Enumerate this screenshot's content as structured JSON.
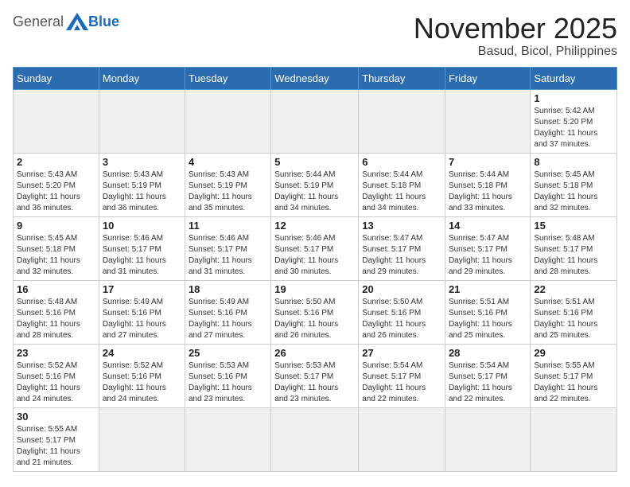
{
  "header": {
    "logo_general": "General",
    "logo_blue": "Blue",
    "month_title": "November 2025",
    "location": "Basud, Bicol, Philippines"
  },
  "weekdays": [
    "Sunday",
    "Monday",
    "Tuesday",
    "Wednesday",
    "Thursday",
    "Friday",
    "Saturday"
  ],
  "weeks": [
    [
      {
        "day": "",
        "info": ""
      },
      {
        "day": "",
        "info": ""
      },
      {
        "day": "",
        "info": ""
      },
      {
        "day": "",
        "info": ""
      },
      {
        "day": "",
        "info": ""
      },
      {
        "day": "",
        "info": ""
      },
      {
        "day": "1",
        "info": "Sunrise: 5:42 AM\nSunset: 5:20 PM\nDaylight: 11 hours\nand 37 minutes."
      }
    ],
    [
      {
        "day": "2",
        "info": "Sunrise: 5:43 AM\nSunset: 5:20 PM\nDaylight: 11 hours\nand 36 minutes."
      },
      {
        "day": "3",
        "info": "Sunrise: 5:43 AM\nSunset: 5:19 PM\nDaylight: 11 hours\nand 36 minutes."
      },
      {
        "day": "4",
        "info": "Sunrise: 5:43 AM\nSunset: 5:19 PM\nDaylight: 11 hours\nand 35 minutes."
      },
      {
        "day": "5",
        "info": "Sunrise: 5:44 AM\nSunset: 5:19 PM\nDaylight: 11 hours\nand 34 minutes."
      },
      {
        "day": "6",
        "info": "Sunrise: 5:44 AM\nSunset: 5:18 PM\nDaylight: 11 hours\nand 34 minutes."
      },
      {
        "day": "7",
        "info": "Sunrise: 5:44 AM\nSunset: 5:18 PM\nDaylight: 11 hours\nand 33 minutes."
      },
      {
        "day": "8",
        "info": "Sunrise: 5:45 AM\nSunset: 5:18 PM\nDaylight: 11 hours\nand 32 minutes."
      }
    ],
    [
      {
        "day": "9",
        "info": "Sunrise: 5:45 AM\nSunset: 5:18 PM\nDaylight: 11 hours\nand 32 minutes."
      },
      {
        "day": "10",
        "info": "Sunrise: 5:46 AM\nSunset: 5:17 PM\nDaylight: 11 hours\nand 31 minutes."
      },
      {
        "day": "11",
        "info": "Sunrise: 5:46 AM\nSunset: 5:17 PM\nDaylight: 11 hours\nand 31 minutes."
      },
      {
        "day": "12",
        "info": "Sunrise: 5:46 AM\nSunset: 5:17 PM\nDaylight: 11 hours\nand 30 minutes."
      },
      {
        "day": "13",
        "info": "Sunrise: 5:47 AM\nSunset: 5:17 PM\nDaylight: 11 hours\nand 29 minutes."
      },
      {
        "day": "14",
        "info": "Sunrise: 5:47 AM\nSunset: 5:17 PM\nDaylight: 11 hours\nand 29 minutes."
      },
      {
        "day": "15",
        "info": "Sunrise: 5:48 AM\nSunset: 5:17 PM\nDaylight: 11 hours\nand 28 minutes."
      }
    ],
    [
      {
        "day": "16",
        "info": "Sunrise: 5:48 AM\nSunset: 5:16 PM\nDaylight: 11 hours\nand 28 minutes."
      },
      {
        "day": "17",
        "info": "Sunrise: 5:49 AM\nSunset: 5:16 PM\nDaylight: 11 hours\nand 27 minutes."
      },
      {
        "day": "18",
        "info": "Sunrise: 5:49 AM\nSunset: 5:16 PM\nDaylight: 11 hours\nand 27 minutes."
      },
      {
        "day": "19",
        "info": "Sunrise: 5:50 AM\nSunset: 5:16 PM\nDaylight: 11 hours\nand 26 minutes."
      },
      {
        "day": "20",
        "info": "Sunrise: 5:50 AM\nSunset: 5:16 PM\nDaylight: 11 hours\nand 26 minutes."
      },
      {
        "day": "21",
        "info": "Sunrise: 5:51 AM\nSunset: 5:16 PM\nDaylight: 11 hours\nand 25 minutes."
      },
      {
        "day": "22",
        "info": "Sunrise: 5:51 AM\nSunset: 5:16 PM\nDaylight: 11 hours\nand 25 minutes."
      }
    ],
    [
      {
        "day": "23",
        "info": "Sunrise: 5:52 AM\nSunset: 5:16 PM\nDaylight: 11 hours\nand 24 minutes."
      },
      {
        "day": "24",
        "info": "Sunrise: 5:52 AM\nSunset: 5:16 PM\nDaylight: 11 hours\nand 24 minutes."
      },
      {
        "day": "25",
        "info": "Sunrise: 5:53 AM\nSunset: 5:16 PM\nDaylight: 11 hours\nand 23 minutes."
      },
      {
        "day": "26",
        "info": "Sunrise: 5:53 AM\nSunset: 5:17 PM\nDaylight: 11 hours\nand 23 minutes."
      },
      {
        "day": "27",
        "info": "Sunrise: 5:54 AM\nSunset: 5:17 PM\nDaylight: 11 hours\nand 22 minutes."
      },
      {
        "day": "28",
        "info": "Sunrise: 5:54 AM\nSunset: 5:17 PM\nDaylight: 11 hours\nand 22 minutes."
      },
      {
        "day": "29",
        "info": "Sunrise: 5:55 AM\nSunset: 5:17 PM\nDaylight: 11 hours\nand 22 minutes."
      }
    ],
    [
      {
        "day": "30",
        "info": "Sunrise: 5:55 AM\nSunset: 5:17 PM\nDaylight: 11 hours\nand 21 minutes."
      },
      {
        "day": "",
        "info": ""
      },
      {
        "day": "",
        "info": ""
      },
      {
        "day": "",
        "info": ""
      },
      {
        "day": "",
        "info": ""
      },
      {
        "day": "",
        "info": ""
      },
      {
        "day": "",
        "info": ""
      }
    ]
  ]
}
